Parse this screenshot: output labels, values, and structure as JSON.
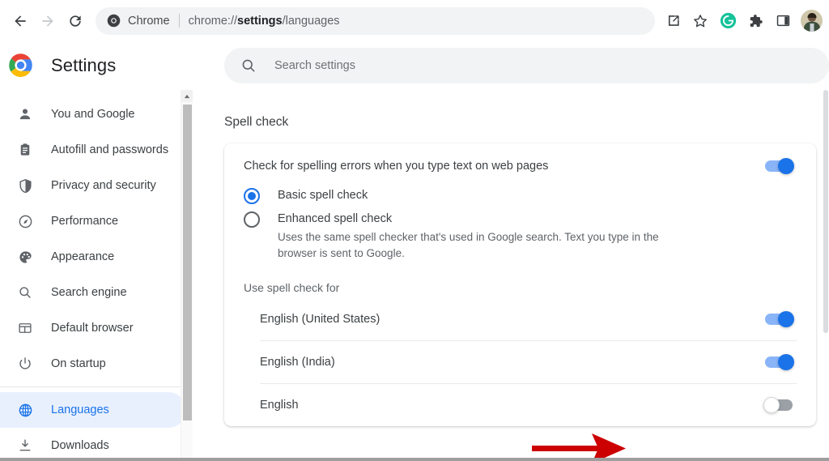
{
  "browser": {
    "nav": {
      "back_icon": "arrow-left-icon",
      "forward_icon": "arrow-right-icon",
      "reload_icon": "reload-icon"
    },
    "omnibox": {
      "chrome_icon": "chrome-icon",
      "label": "Chrome",
      "url_prefix": "chrome://",
      "url_bold": "settings",
      "url_suffix": "/languages",
      "url_full": "chrome://settings/languages"
    },
    "tools": [
      {
        "name": "share-icon",
        "label": "Share"
      },
      {
        "name": "bookmark-star-icon",
        "label": "Bookmark this tab"
      },
      {
        "name": "grammarly-extension-icon",
        "label": "Grammarly",
        "color": "#15C39A"
      },
      {
        "name": "extensions-puzzle-icon",
        "label": "Extensions"
      },
      {
        "name": "side-panel-icon",
        "label": "Side panel"
      }
    ],
    "avatar": {
      "name": "profile-avatar",
      "label": "Profile"
    }
  },
  "settings_header": {
    "logo_icon": "chrome-logo-icon",
    "title": "Settings",
    "search": {
      "icon": "search-icon",
      "placeholder": "Search settings",
      "value": ""
    }
  },
  "sidebar": {
    "items": [
      {
        "id": "you-and-google",
        "label": "You and Google",
        "icon": "person-icon",
        "selected": false
      },
      {
        "id": "autofill-passwords",
        "label": "Autofill and passwords",
        "icon": "clipboard-icon",
        "selected": false
      },
      {
        "id": "privacy-security",
        "label": "Privacy and security",
        "icon": "shield-icon",
        "selected": false
      },
      {
        "id": "performance",
        "label": "Performance",
        "icon": "speedometer-icon",
        "selected": false
      },
      {
        "id": "appearance",
        "label": "Appearance",
        "icon": "palette-icon",
        "selected": false
      },
      {
        "id": "search-engine",
        "label": "Search engine",
        "icon": "search-icon",
        "selected": false
      },
      {
        "id": "default-browser",
        "label": "Default browser",
        "icon": "browser-window-icon",
        "selected": false
      },
      {
        "id": "on-startup",
        "label": "On startup",
        "icon": "power-icon",
        "selected": false
      },
      {
        "id": "languages",
        "label": "Languages",
        "icon": "globe-icon",
        "selected": true
      },
      {
        "id": "downloads",
        "label": "Downloads",
        "icon": "download-icon",
        "selected": false
      }
    ],
    "divider_after_index": 7
  },
  "main": {
    "section_title": "Spell check",
    "spellcheck_toggle": {
      "label": "Check for spelling errors when you type text on web pages",
      "state": "on"
    },
    "radio_options": [
      {
        "id": "basic-spell-check",
        "label": "Basic spell check",
        "description": "",
        "checked": true
      },
      {
        "id": "enhanced-spell-check",
        "label": "Enhanced spell check",
        "description": "Uses the same spell checker that's used in Google search. Text you type in the browser is sent to Google.",
        "checked": false
      }
    ],
    "use_spellcheck_for_label": "Use spell check for",
    "languages": [
      {
        "id": "english-united-states",
        "label": "English (United States)",
        "state": "on"
      },
      {
        "id": "english-india",
        "label": "English (India)",
        "state": "on"
      },
      {
        "id": "english",
        "label": "English",
        "state": "off"
      }
    ]
  },
  "annotation": {
    "arrow": {
      "name": "red-annotation-arrow",
      "color": "#CC0000",
      "points_to": "english-united-states-toggle"
    }
  },
  "colors": {
    "accent_blue": "#1A73E8",
    "toggle_track_on": "#8AB4F8",
    "toggle_track_off": "#9AA0A6",
    "selected_pill": "#E8F0FE",
    "text_primary": "#3C4043",
    "text_secondary": "#5F6368",
    "omnibox_bg": "#F1F3F4",
    "annotation_red": "#CC0000"
  }
}
